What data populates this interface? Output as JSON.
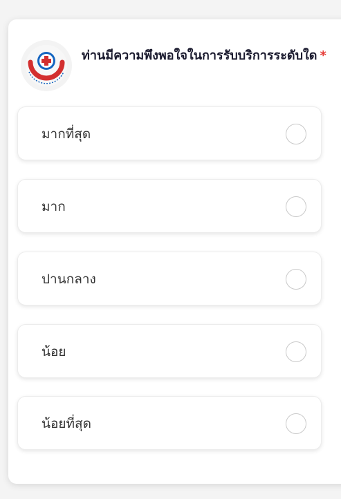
{
  "question": {
    "text": "ท่านมีความพึงพอใจในการรับบริการระดับใด",
    "required_marker": "*"
  },
  "logo": {
    "icon": "hospital-logo-icon",
    "colors": {
      "red": "#d32f2f",
      "blue": "#1565c0"
    }
  },
  "options": [
    {
      "label": "มากที่สุด",
      "selected": false
    },
    {
      "label": "มาก",
      "selected": false
    },
    {
      "label": "ปานกลาง",
      "selected": false
    },
    {
      "label": "น้อย",
      "selected": false
    },
    {
      "label": "น้อยที่สุด",
      "selected": false
    }
  ],
  "colors": {
    "required": "#e53935",
    "radio_border": "#c9c9c9",
    "text": "#333333"
  }
}
